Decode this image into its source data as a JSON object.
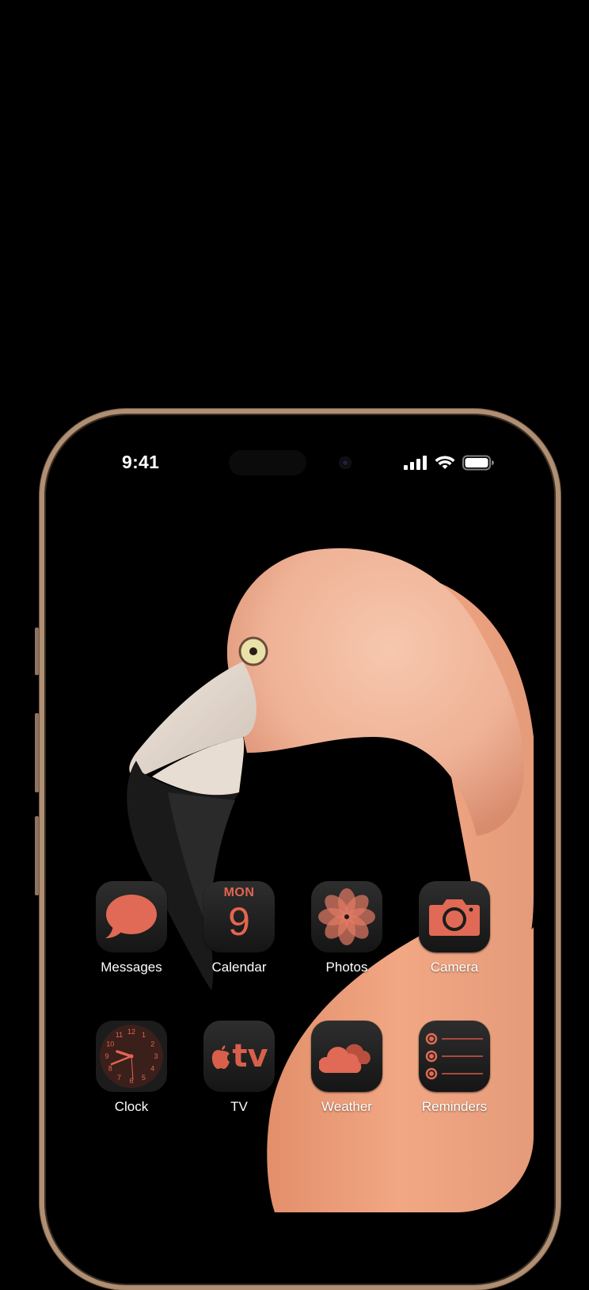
{
  "status_bar": {
    "time": "9:41"
  },
  "apps": [
    {
      "label": "Messages",
      "icon": "messages-icon"
    },
    {
      "label": "Calendar",
      "icon": "calendar-icon",
      "day": "MON",
      "date": "9"
    },
    {
      "label": "Photos",
      "icon": "photos-icon"
    },
    {
      "label": "Camera",
      "icon": "camera-icon"
    },
    {
      "label": "Clock",
      "icon": "clock-icon",
      "dial_numbers": [
        "12",
        "1",
        "2",
        "3",
        "4",
        "5",
        "6",
        "7",
        "8",
        "9",
        "10",
        "11"
      ]
    },
    {
      "label": "TV",
      "icon": "apple-tv-icon",
      "tv_text": "tv"
    },
    {
      "label": "Weather",
      "icon": "weather-icon"
    },
    {
      "label": "Reminders",
      "icon": "reminders-icon"
    }
  ],
  "colors": {
    "accent": "#e26550",
    "frame": "#b08f72",
    "flamingo": "#f2b49a"
  }
}
